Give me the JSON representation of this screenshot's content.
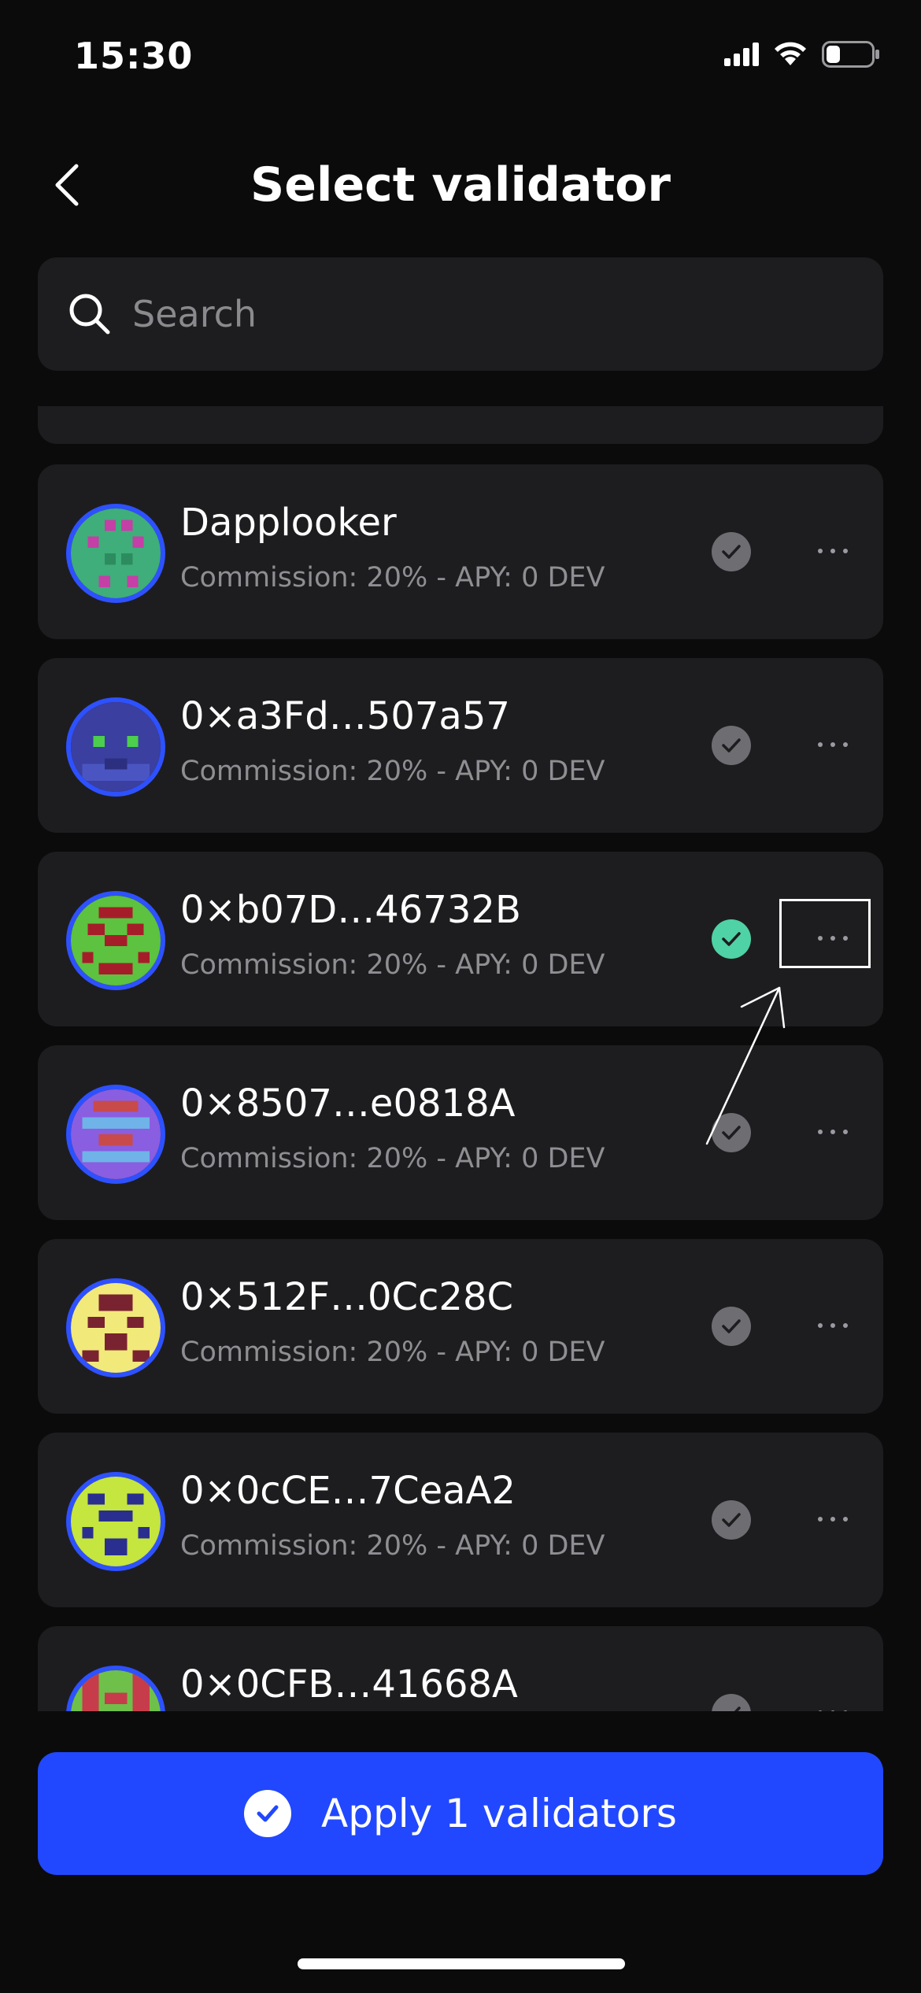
{
  "status_bar": {
    "time": "15:30"
  },
  "header": {
    "title": "Select validator"
  },
  "search": {
    "placeholder": "Search",
    "value": ""
  },
  "validators": [
    {
      "name": "Dapplooker",
      "meta": "Commission: 20% - APY: 0 DEV",
      "selected": false
    },
    {
      "name": "0×a3Fd…507a57",
      "meta": "Commission: 20% - APY: 0 DEV",
      "selected": false
    },
    {
      "name": "0×b07D…46732B",
      "meta": "Commission: 20% - APY: 0 DEV",
      "selected": true
    },
    {
      "name": "0×8507…e0818A",
      "meta": "Commission: 20% - APY: 0 DEV",
      "selected": false
    },
    {
      "name": "0×512F…0Cc28C",
      "meta": "Commission: 20% - APY: 0 DEV",
      "selected": false
    },
    {
      "name": "0×0cCE…7CeaA2",
      "meta": "Commission: 20% - APY: 0 DEV",
      "selected": false
    },
    {
      "name": "0×0CFB…41668A",
      "meta": "",
      "selected": false
    }
  ],
  "icons": {
    "back": "chevron-left-icon",
    "search": "search-icon",
    "check": "check-circle-icon",
    "more": "ellipsis-icon",
    "apply": "check-circle-icon"
  },
  "colors": {
    "accent": "#2148ff",
    "selected_check": "#4fd2a5",
    "unselected_check": "#6d6d72",
    "avatar_ring": "#2e51ff"
  },
  "apply_button": {
    "label": "Apply 1 validators"
  }
}
